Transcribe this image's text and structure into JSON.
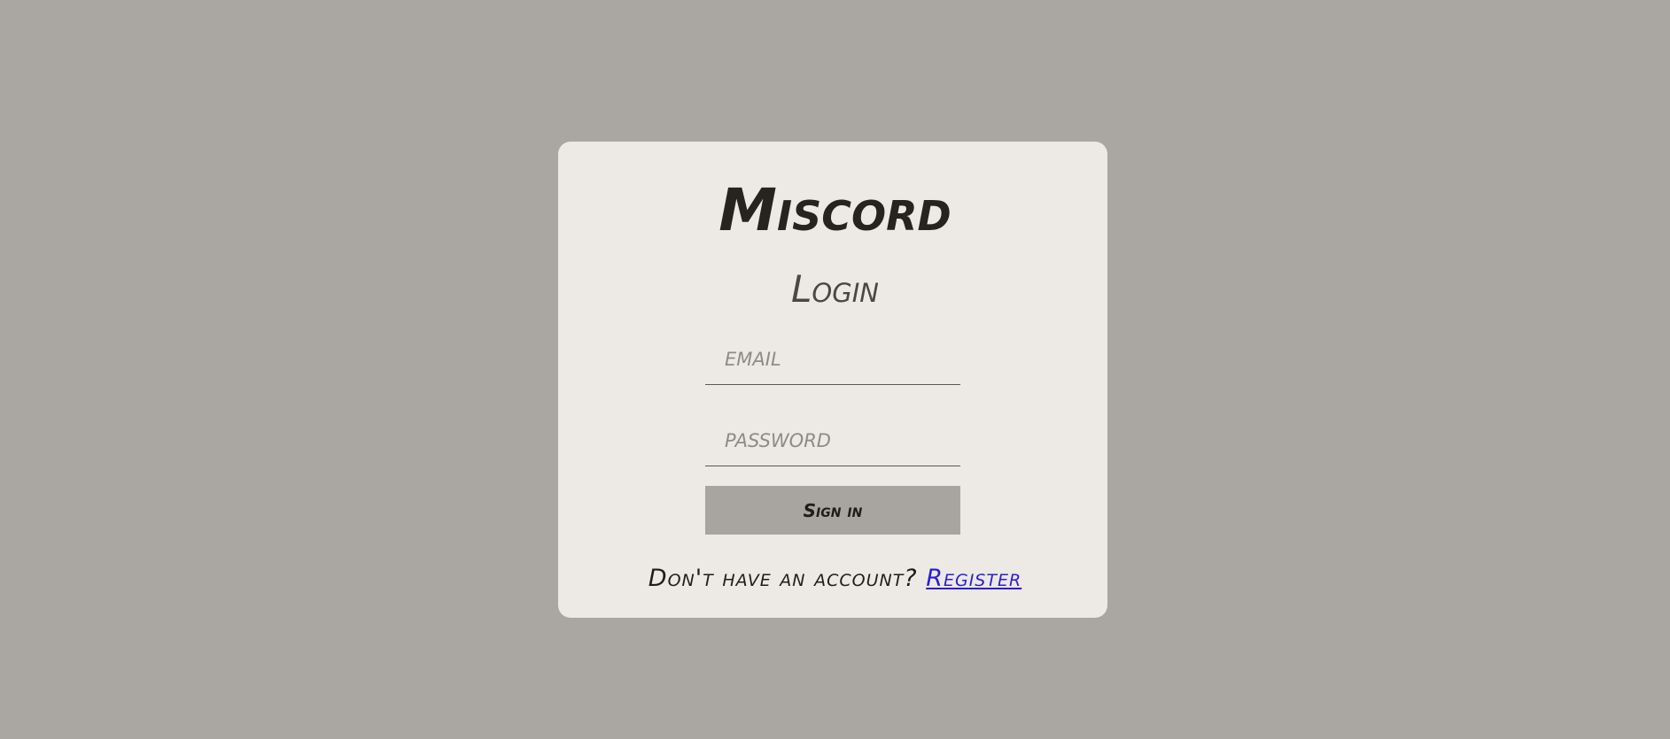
{
  "app": {
    "brand": "Miscord"
  },
  "login_form": {
    "heading": "Login",
    "email_placeholder": "EMAIL",
    "email_value": "",
    "password_placeholder": "PASSWORD",
    "password_value": "",
    "submit_label": "Sign in"
  },
  "footer": {
    "prompt": "Don't have an account?",
    "register_label": "Register"
  },
  "colors": {
    "background": "#aaa6a1",
    "card": "#ede9e5",
    "button": "#a8a49f",
    "link": "#2b1fd1",
    "text": "#262320"
  }
}
